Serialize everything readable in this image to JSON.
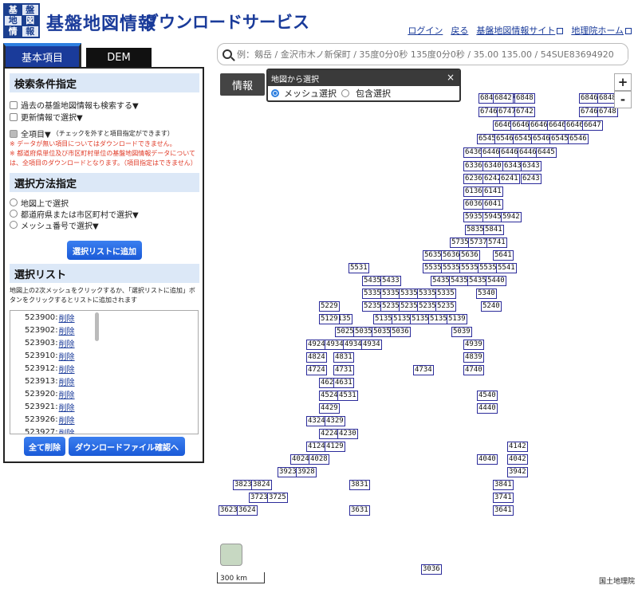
{
  "header": {
    "logo_chars": [
      "基",
      "盤",
      "地",
      "図",
      "情",
      "報"
    ],
    "title": "基盤地図情報",
    "subtitle": "ダウンロードサービス",
    "links": [
      {
        "label": "ログイン",
        "external": false
      },
      {
        "label": "戻る",
        "external": false
      },
      {
        "label": "基盤地図情報サイト",
        "external": true
      },
      {
        "label": "地理院ホーム",
        "external": true
      }
    ]
  },
  "tabs": [
    {
      "label": "基本項目",
      "active": true
    },
    {
      "label": "DEM",
      "active": false
    }
  ],
  "panel": {
    "search_section": "検索条件指定",
    "past_info": "過去の基盤地図情報も検索する▼",
    "updated_info": "更新情報で選択▼",
    "all_items": "全項目▼",
    "all_items_note": "（チェックを外すと項目指定ができます）",
    "notes": [
      "※ データが無い項目についてはダウンロードできません。",
      "※ 都道府県単位及び市区町村単位の基盤地図情報データについては、全項目のダウンロードとなります。（項目指定はできません）"
    ],
    "select_section": "選択方法指定",
    "methods": [
      "地図上で選択",
      "都道府県または市区町村で選択▼",
      "メッシュ番号で選択▼"
    ],
    "add_button": "選択リストに追加",
    "list_section": "選択リスト",
    "list_desc": "地図上の2次メッシュをクリックするか、「選択リストに追加」ボタンをクリックするとリストに追加されます",
    "delete_label": "削除",
    "list_items": [
      "523900",
      "523902",
      "523903",
      "523910",
      "523912",
      "523913",
      "523920",
      "523921",
      "523926",
      "523927"
    ],
    "delete_all": "全て削除",
    "confirm_download": "ダウンロードファイル確認へ"
  },
  "map": {
    "search_placeholder": "例：剱岳 / 金沢市木ノ新保町 / 35度0分0秒 135度0分0秒 / 35.00 135.00 / 54SUE83694920",
    "info_button": "情報",
    "popup_title": "地図から選択",
    "popup_close": "×",
    "popup_options": [
      "メッシュ選択",
      "包含選択"
    ],
    "popup_selected": "メッシュ選択",
    "zoom_in": "+",
    "zoom_out": "-",
    "scale_label": "300 km",
    "attribution": "国土地理院",
    "meshes": [
      "6846",
      "6847",
      "6848",
      "6842",
      "6846",
      "6848",
      "6746",
      "6747",
      "6742",
      "6746",
      "6748",
      "6646",
      "6646",
      "6646",
      "6646",
      "6646",
      "6647",
      "6545",
      "6546",
      "6545",
      "6546",
      "6545",
      "6546",
      "6436",
      "6446",
      "6446",
      "6446",
      "6445",
      "6336",
      "6340",
      "6343",
      "6343",
      "6236",
      "6242",
      "6241",
      "6243",
      "6136",
      "6141",
      "6036",
      "6041",
      "5935",
      "5945",
      "5942",
      "5835",
      "5841",
      "5735",
      "5737",
      "5741",
      "5635",
      "5636",
      "5636",
      "5641",
      "5535",
      "5535",
      "5535",
      "5535",
      "5541",
      "5531",
      "5435",
      "5433",
      "5435",
      "5435",
      "5435",
      "5440",
      "5335",
      "5335",
      "5335",
      "5335",
      "5335",
      "5340",
      "5235",
      "5235",
      "5235",
      "5235",
      "5235",
      "5240",
      "5229",
      "5135",
      "5135",
      "5135",
      "5135",
      "5135",
      "5139",
      "5129",
      "5025",
      "5035",
      "5035",
      "5036",
      "5039",
      "4924",
      "4934",
      "4934",
      "4934",
      "4939",
      "4824",
      "4831",
      "4839",
      "4724",
      "4731",
      "4734",
      "4740",
      "4624",
      "4631",
      "4524",
      "4531",
      "4540",
      "4429",
      "4440",
      "4324",
      "4329",
      "4224",
      "4230",
      "4124",
      "4129",
      "4142",
      "4024",
      "4028",
      "4040",
      "4042",
      "3923",
      "3928",
      "3942",
      "3823",
      "3824",
      "3831",
      "3841",
      "3723",
      "3725",
      "3741",
      "3623",
      "3624",
      "3631",
      "3641",
      "3036"
    ]
  }
}
